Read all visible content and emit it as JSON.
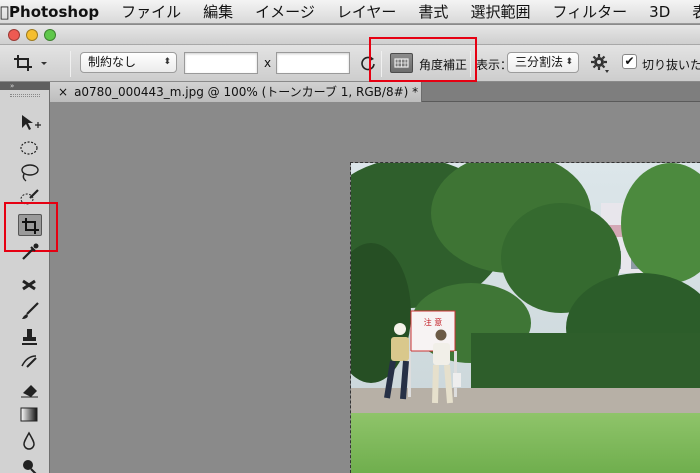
{
  "menubar": {
    "app_name": "Photoshop",
    "items": [
      "ファイル",
      "編集",
      "イメージ",
      "レイヤー",
      "書式",
      "選択範囲",
      "フィルター",
      "3D",
      "表示"
    ]
  },
  "options_bar": {
    "ratio_select": "制約なし",
    "times_symbol": "x",
    "straighten_label": "角度補正",
    "view_label": "表示：",
    "overlay_select": "三分割法",
    "delete_cropped_label": "切り抜いた"
  },
  "document": {
    "tab_title": "a0780_000443_m.jpg @ 100% (トーンカーブ 1, RGB/8#) *",
    "close_glyph": "×"
  },
  "photo": {
    "sign_text": "注 意"
  },
  "toolbox": {
    "collapse_glyph": "»",
    "tools": [
      "move-tool",
      "marquee-tool",
      "lasso-tool",
      "quick-selection-tool",
      "crop-tool",
      "eyedropper-tool",
      "healing-brush-tool",
      "brush-tool",
      "clone-stamp-tool",
      "history-brush-tool",
      "eraser-tool",
      "gradient-tool",
      "blur-tool",
      "dodge-tool"
    ]
  },
  "colors": {
    "highlight": "#e60012",
    "workspace": "#8a8a8a",
    "traffic_close": "#ee5a52",
    "traffic_min": "#f5be2f",
    "traffic_max": "#5fc74a"
  }
}
